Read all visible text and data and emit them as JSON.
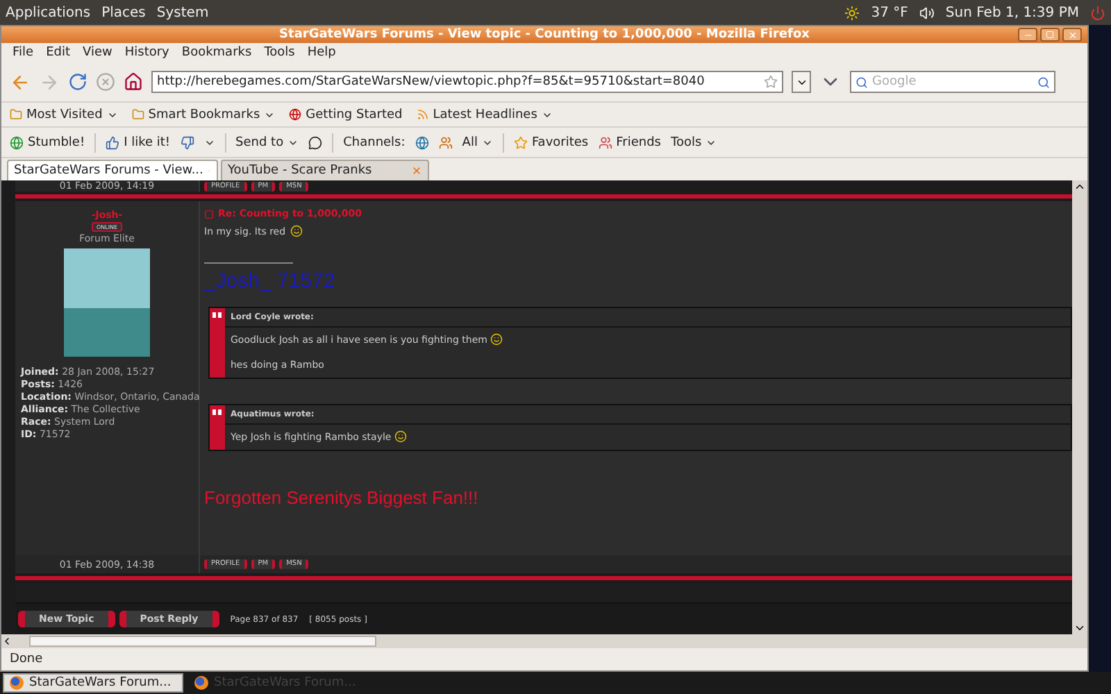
{
  "top_panel": {
    "menus": [
      "Applications",
      "Places",
      "System"
    ],
    "weather": "37 °F",
    "clock": "Sun Feb  1,  1:39 PM"
  },
  "window": {
    "title": "StarGateWars Forums - View topic - Counting to 1,000,000 - Mozilla Firefox"
  },
  "menu": [
    "File",
    "Edit",
    "View",
    "History",
    "Bookmarks",
    "Tools",
    "Help"
  ],
  "nav": {
    "url": "http://herebegames.com/StarGateWarsNew/viewtopic.php?f=85&t=95710&start=8040",
    "search_placeholder": "Google"
  },
  "bookmarks": [
    {
      "label": "Most Visited",
      "dropdown": true
    },
    {
      "label": "Smart Bookmarks",
      "dropdown": true
    },
    {
      "label": "Getting Started",
      "dropdown": false
    },
    {
      "label": "Latest Headlines",
      "dropdown": true
    }
  ],
  "stumble": {
    "stumble": "Stumble!",
    "like": "I like it!",
    "send": "Send to",
    "channels": "Channels:",
    "all": "All",
    "favorites": "Favorites",
    "friends": "Friends",
    "tools": "Tools"
  },
  "tabs": [
    {
      "label": "StarGateWars Forums - View...",
      "selected": true
    },
    {
      "label": "YouTube - Scare Pranks",
      "selected": false
    }
  ],
  "forum": {
    "previous": {
      "date": "01 Feb 2009, 14:19",
      "buttons": [
        "PROFILE",
        "PM",
        "MSN"
      ]
    },
    "post": {
      "author": "-Josh-",
      "status": "ONLINE",
      "rank": "Forum Elite",
      "details": [
        {
          "label": "Joined:",
          "value": "28 Jan 2008, 15:27"
        },
        {
          "label": "Posts:",
          "value": "1426"
        },
        {
          "label": "Location:",
          "value": "Windsor, Ontario, Canada"
        },
        {
          "label": "Alliance:",
          "value": "The Collective"
        },
        {
          "label": "Race:",
          "value": "System Lord"
        },
        {
          "label": "ID:",
          "value": "71572"
        }
      ],
      "title": "Re: Counting to 1,000,000",
      "body": "In my sig. Its red",
      "signature_name": "_Josh_ 71572",
      "quotes": [
        {
          "author": "Lord Coyle wrote:",
          "lines": [
            "Goodluck Josh as all i have seen is you fighting them",
            "hes doing a Rambo"
          ]
        },
        {
          "author": "Aquatimus wrote:",
          "lines": [
            "Yep Josh is fighting Rambo stayle"
          ]
        }
      ],
      "signature_text": "Forgotten Serenitys Biggest Fan!!!",
      "date": "01 Feb 2009, 14:38",
      "buttons": [
        "PROFILE",
        "PM",
        "MSN"
      ]
    },
    "actions": [
      "New Topic",
      "Post Reply"
    ],
    "pagination": "Page 837 of 837",
    "posts": "[ 8055 posts ]"
  },
  "status": "Done",
  "taskbar": [
    {
      "label": "StarGateWars Forum...",
      "selected": true
    },
    {
      "label": "StarGateWars Forum...",
      "selected": false
    }
  ]
}
